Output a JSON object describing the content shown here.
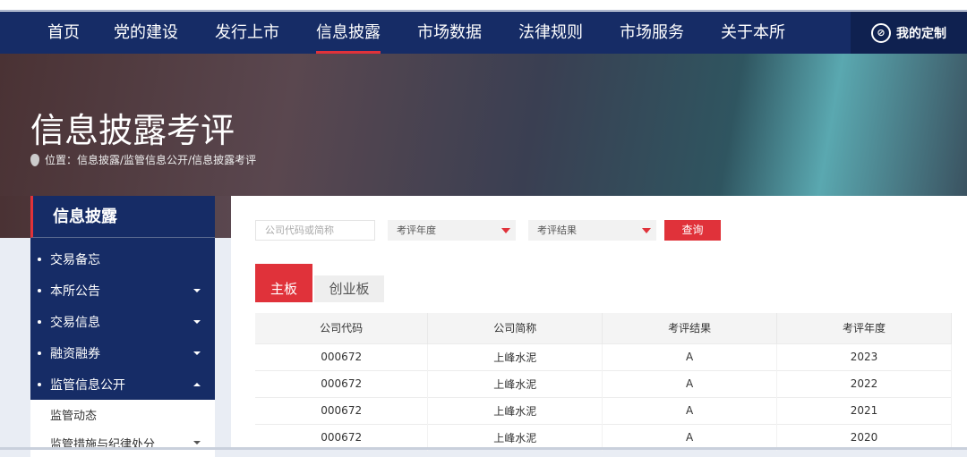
{
  "nav": {
    "items": [
      "首页",
      "党的建设",
      "发行上市",
      "信息披露",
      "市场数据",
      "法律规则",
      "市场服务",
      "关于本所"
    ],
    "active": 3,
    "custom_label": "我的定制"
  },
  "banner": {
    "title": "信息披露考评",
    "crumb_prefix": "位置：",
    "crumb": "信息披露/监管信息公开/信息披露考评"
  },
  "sidebar": {
    "title": "信息披露",
    "items": [
      {
        "label": "交易备忘",
        "caret": ""
      },
      {
        "label": "本所公告",
        "caret": "down"
      },
      {
        "label": "交易信息",
        "caret": "down"
      },
      {
        "label": "融资融券",
        "caret": "down"
      },
      {
        "label": "监管信息公开",
        "caret": "up"
      }
    ],
    "sub": [
      "监管动态",
      "监管措施与纪律处分"
    ]
  },
  "filters": {
    "code_placeholder": "公司代码或简称",
    "year_label": "考评年度",
    "result_label": "考评结果",
    "query": "查询"
  },
  "tabs": [
    "主板",
    "创业板"
  ],
  "table": {
    "headers": [
      "公司代码",
      "公司简称",
      "考评结果",
      "考评年度"
    ],
    "rows": [
      [
        "000672",
        "上峰水泥",
        "A",
        "2023"
      ],
      [
        "000672",
        "上峰水泥",
        "A",
        "2022"
      ],
      [
        "000672",
        "上峰水泥",
        "A",
        "2021"
      ],
      [
        "000672",
        "上峰水泥",
        "A",
        "2020"
      ]
    ]
  },
  "colors": {
    "navy": "#162c66",
    "accent": "#e0323a"
  }
}
